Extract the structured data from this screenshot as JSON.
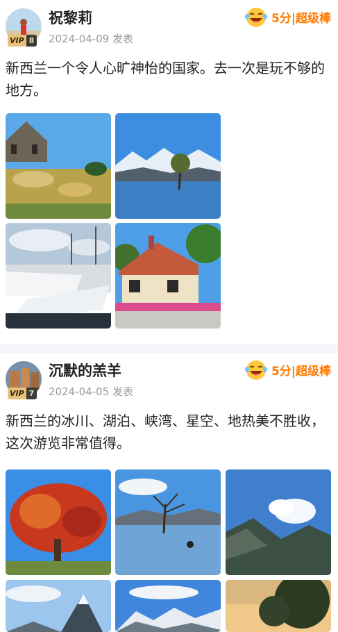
{
  "posts": [
    {
      "username": "祝黎莉",
      "vip_label": "VIP",
      "vip_level": "8",
      "date": "2024-04-09",
      "date_suffix": "发表",
      "score": "5分",
      "rating_label": "|超级棒",
      "text": "新西兰一个令人心旷神怡的国家。去一次是玩不够的地方。",
      "photos": [
        "stone-church",
        "lone-tree-lake",
        "marina-yachts",
        "heritage-cottage"
      ]
    },
    {
      "username": "沉默的羔羊",
      "vip_label": "VIP",
      "vip_level": "7",
      "date": "2024-04-05",
      "date_suffix": "发表",
      "score": "5分",
      "rating_label": "|超级棒",
      "text": "新西兰的冰川、湖泊、峡湾、星空、地热美不胜收，这次游览非常值得。",
      "photos": [
        "autumn-tree",
        "lone-tree-lake",
        "fiord-clouds",
        "mitre-peak",
        "snowy-range",
        "tree-silhouette"
      ]
    }
  ],
  "colors": {
    "accent": "#ff7a00",
    "divider": "#f4f6fa",
    "vip_gold": "#e8c27a"
  },
  "icons": {
    "rating": "laughing-face-icon"
  }
}
